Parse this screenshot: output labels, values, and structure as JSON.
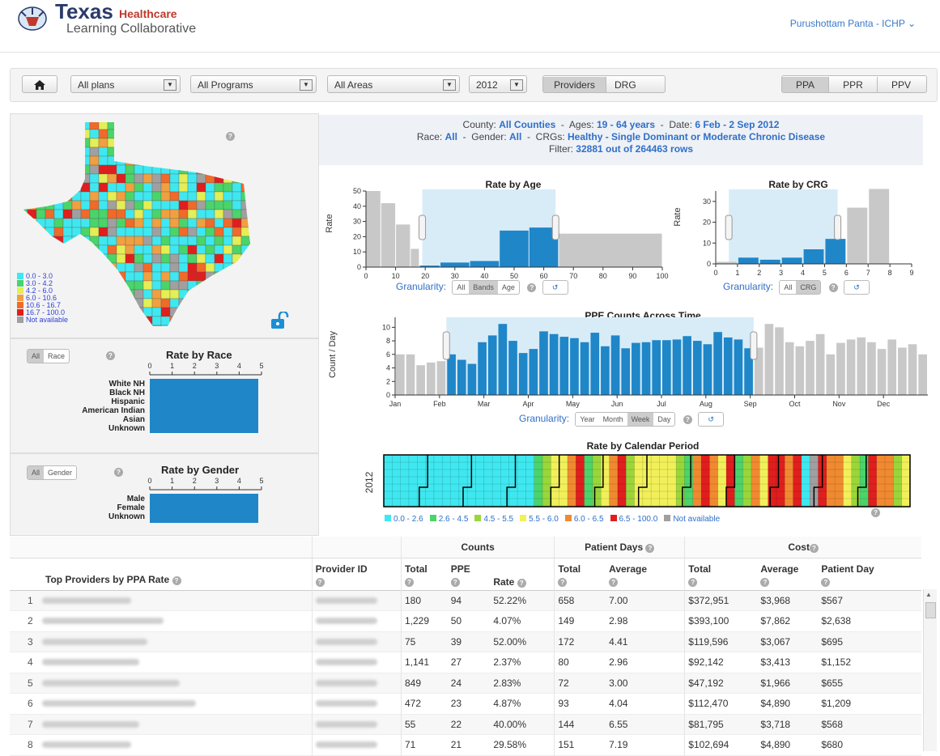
{
  "header": {
    "brand_texas": "Texas",
    "brand_healthcare": "Healthcare",
    "brand_subtitle": "Learning Collaborative",
    "user_menu": "Purushottam Panta - ICHP ⌄"
  },
  "toolbar": {
    "plans": "All plans",
    "programs": "All Programs",
    "areas": "All Areas",
    "year": "2012",
    "view_toggle": [
      "Providers",
      "DRG"
    ],
    "view_selected": "Providers",
    "measure_toggle": [
      "PPA",
      "PPR",
      "PPV"
    ],
    "measure_selected": "PPA"
  },
  "summary": {
    "county_label": "County:",
    "county": "All Counties",
    "ages_label": "Ages:",
    "ages": "19 - 64 years",
    "date_label": "Date:",
    "date": "6 Feb - 2 Sep 2012",
    "race_label": "Race:",
    "race": "All",
    "gender_label": "Gender:",
    "gender": "All",
    "crg_label": "CRGs:",
    "crg": "Healthy - Single Dominant or Moderate Chronic Disease",
    "filter_label": "Filter:",
    "filter": "32881 out of 264463 rows"
  },
  "map_legend": {
    "items": [
      "0.0 - 3.0",
      "3.0 - 4.2",
      "4.2 - 6.0",
      "6.0 - 10.6",
      "10.6 - 16.7",
      "16.7 - 100.0",
      "Not available"
    ],
    "colors": [
      "#3fe8f0",
      "#4ad46a",
      "#e4ee55",
      "#f0a040",
      "#f06a2a",
      "#e01e1e",
      "#a0a0a0"
    ]
  },
  "race_panel": {
    "toggle": [
      "All",
      "Race"
    ],
    "title": "Rate by Race",
    "ticks": [
      "0",
      "1",
      "2",
      "3",
      "4",
      "5"
    ],
    "categories": [
      "White NH",
      "Black NH",
      "Hispanic",
      "American Indian",
      "Asian",
      "Unknown"
    ]
  },
  "gender_panel": {
    "toggle": [
      "All",
      "Gender"
    ],
    "title": "Rate by Gender",
    "ticks": [
      "0",
      "1",
      "2",
      "3",
      "4",
      "5"
    ],
    "categories": [
      "Male",
      "Female",
      "Unknown"
    ]
  },
  "age_chart": {
    "title": "Rate by Age",
    "ylabel": "Rate",
    "granularity_label": "Granularity:",
    "granularity": [
      "All",
      "Bands",
      "Age"
    ],
    "granularity_selected": "Bands"
  },
  "crg_chart": {
    "title": "Rate by CRG",
    "ylabel": "Rate",
    "granularity_label": "Granularity:",
    "granularity": [
      "All",
      "CRG"
    ],
    "granularity_selected": "CRG"
  },
  "time_chart": {
    "title": "PPE Counts Across Time",
    "ylabel": "Count / Day",
    "granularity_label": "Granularity:",
    "granularity": [
      "Year",
      "Month",
      "Week",
      "Day"
    ],
    "granularity_selected": "Week"
  },
  "calendar_chart": {
    "title": "Rate by Calendar Period",
    "row_label": "2012",
    "legend": [
      "0.0 - 2.6",
      "2.6 - 4.5",
      "4.5 - 5.5",
      "5.5 - 6.0",
      "6.0 - 6.5",
      "6.5 - 100.0",
      "Not available"
    ],
    "legend_colors": [
      "#3fe8f0",
      "#4ad46a",
      "#9ad63a",
      "#f2f05a",
      "#f08a30",
      "#e01e1e",
      "#a0a0a0"
    ]
  },
  "chart_data": [
    {
      "type": "bar",
      "title": "Rate by Age",
      "ylabel": "Rate",
      "xlim": [
        0,
        100
      ],
      "ylim": [
        0,
        50
      ],
      "x_ticks": [
        0,
        10,
        20,
        30,
        40,
        50,
        60,
        70,
        80,
        90,
        100
      ],
      "y_ticks": [
        0,
        10,
        20,
        30,
        40,
        50
      ],
      "selection": [
        19,
        64
      ],
      "bars": [
        {
          "x0": 0,
          "x1": 5,
          "value": 50,
          "selected": false
        },
        {
          "x0": 5,
          "x1": 10,
          "value": 42,
          "selected": false
        },
        {
          "x0": 10,
          "x1": 15,
          "value": 28,
          "selected": false
        },
        {
          "x0": 15,
          "x1": 18,
          "value": 12,
          "selected": false
        },
        {
          "x0": 18,
          "x1": 25,
          "value": 1,
          "selected": true
        },
        {
          "x0": 25,
          "x1": 35,
          "value": 3,
          "selected": true
        },
        {
          "x0": 35,
          "x1": 45,
          "value": 4,
          "selected": true
        },
        {
          "x0": 45,
          "x1": 55,
          "value": 24,
          "selected": true
        },
        {
          "x0": 55,
          "x1": 65,
          "value": 26,
          "selected": true
        },
        {
          "x0": 65,
          "x1": 100,
          "value": 22,
          "selected": false
        }
      ]
    },
    {
      "type": "bar",
      "title": "Rate by CRG",
      "ylabel": "Rate",
      "xlim": [
        0,
        9
      ],
      "ylim": [
        0,
        35
      ],
      "x_ticks": [
        0,
        1,
        2,
        3,
        4,
        5,
        6,
        7,
        8,
        9
      ],
      "y_ticks": [
        0,
        10,
        20,
        30
      ],
      "categories": [
        "0",
        "1",
        "2",
        "3",
        "4",
        "5",
        "6",
        "7",
        "8"
      ],
      "values": [
        1,
        3,
        2,
        3,
        7,
        12,
        27,
        36,
        0
      ],
      "selected": [
        false,
        true,
        true,
        true,
        true,
        true,
        false,
        false,
        false
      ]
    },
    {
      "type": "bar",
      "title": "PPE Counts Across Time",
      "ylabel": "Count / Day",
      "ylim": [
        0,
        11
      ],
      "y_ticks": [
        0,
        2,
        4,
        6,
        8,
        10
      ],
      "x_labels": [
        "Jan",
        "Feb",
        "Mar",
        "Apr",
        "May",
        "Jun",
        "Jul",
        "Aug",
        "Sep",
        "Oct",
        "Nov",
        "Dec"
      ],
      "weeks": 52,
      "values": [
        6.0,
        6.0,
        4.4,
        4.8,
        5.0,
        6.0,
        5.2,
        4.6,
        7.8,
        8.8,
        10.5,
        8.0,
        6.2,
        6.8,
        9.4,
        9.0,
        8.6,
        8.4,
        7.8,
        9.2,
        7.2,
        8.8,
        6.9,
        7.7,
        7.8,
        8.1,
        8.1,
        8.2,
        8.7,
        8.0,
        7.5,
        9.3,
        8.5,
        8.2,
        6.9,
        7.0,
        10.5,
        10.0,
        7.8,
        7.2,
        8.0,
        9.0,
        6.0,
        7.7,
        8.2,
        8.5,
        7.8,
        6.8,
        8.2,
        7.0,
        7.5,
        6.0
      ],
      "selection_weeks": [
        5,
        35
      ]
    }
  ],
  "table": {
    "title": "Top Providers by PPA Rate",
    "group_headers": [
      "Counts",
      "Patient Days",
      "Cost"
    ],
    "columns": [
      "Provider ID",
      "Total",
      "PPE",
      "Rate",
      "Total",
      "Average",
      "Total",
      "Average",
      "Patient Day"
    ],
    "rows": [
      {
        "rank": "1",
        "total": "180",
        "ppe": "94",
        "rate": "52.22%",
        "days_total": "658",
        "days_avg": "7.00",
        "cost_total": "$372,951",
        "cost_avg": "$3,968",
        "cost_day": "$567"
      },
      {
        "rank": "2",
        "total": "1,229",
        "ppe": "50",
        "rate": "4.07%",
        "days_total": "149",
        "days_avg": "2.98",
        "cost_total": "$393,100",
        "cost_avg": "$7,862",
        "cost_day": "$2,638"
      },
      {
        "rank": "3",
        "total": "75",
        "ppe": "39",
        "rate": "52.00%",
        "days_total": "172",
        "days_avg": "4.41",
        "cost_total": "$119,596",
        "cost_avg": "$3,067",
        "cost_day": "$695"
      },
      {
        "rank": "4",
        "total": "1,141",
        "ppe": "27",
        "rate": "2.37%",
        "days_total": "80",
        "days_avg": "2.96",
        "cost_total": "$92,142",
        "cost_avg": "$3,413",
        "cost_day": "$1,152"
      },
      {
        "rank": "5",
        "total": "849",
        "ppe": "24",
        "rate": "2.83%",
        "days_total": "72",
        "days_avg": "3.00",
        "cost_total": "$47,192",
        "cost_avg": "$1,966",
        "cost_day": "$655"
      },
      {
        "rank": "6",
        "total": "472",
        "ppe": "23",
        "rate": "4.87%",
        "days_total": "93",
        "days_avg": "4.04",
        "cost_total": "$112,470",
        "cost_avg": "$4,890",
        "cost_day": "$1,209"
      },
      {
        "rank": "7",
        "total": "55",
        "ppe": "22",
        "rate": "40.00%",
        "days_total": "144",
        "days_avg": "6.55",
        "cost_total": "$81,795",
        "cost_avg": "$3,718",
        "cost_day": "$568"
      },
      {
        "rank": "8",
        "total": "71",
        "ppe": "21",
        "rate": "29.58%",
        "days_total": "151",
        "days_avg": "7.19",
        "cost_total": "$102,694",
        "cost_avg": "$4,890",
        "cost_day": "$680"
      }
    ]
  }
}
